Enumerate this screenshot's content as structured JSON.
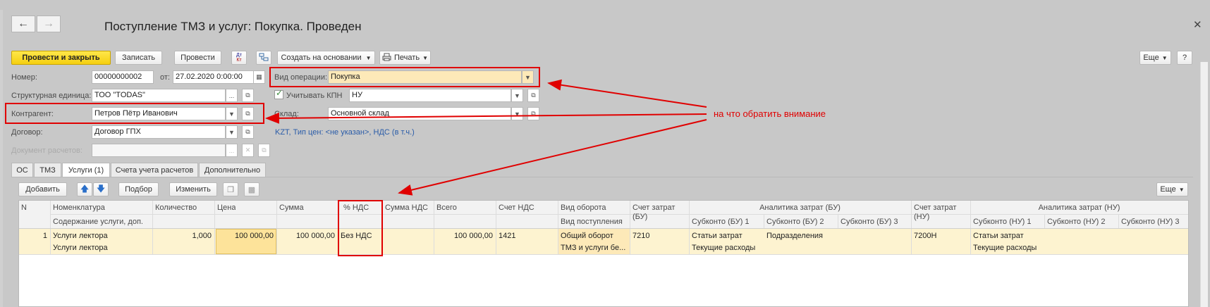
{
  "window": {
    "title": "Поступление ТМЗ и услуг: Покупка. Проведен",
    "close_icon": "close-icon",
    "star_icon": "star-icon"
  },
  "nav": {
    "back_icon": "arrow-left-icon",
    "forward_icon": "arrow-right-icon"
  },
  "toolbar": {
    "post_close": "Провести и закрыть",
    "save": "Записать",
    "post": "Провести",
    "dtkt_top": "Дт",
    "dtkt_bottom": "Кт",
    "create_based": "Создать на основании",
    "print": "Печать",
    "more": "Еще",
    "help": "?"
  },
  "form": {
    "number_label": "Номер:",
    "number_value": "00000000002",
    "date_label": "от:",
    "date_value": "27.02.2020  0:00:00",
    "operation_label": "Вид операции:",
    "operation_value": "Покупка",
    "unit_label": "Структурная единица:",
    "unit_value": "ТОО \"TODAS\"",
    "kpn_label": "Учитывать КПН",
    "kpn_value": "НУ",
    "counterparty_label": "Контрагент:",
    "counterparty_value": "Петров Пётр Иванович",
    "warehouse_label": "Склад:",
    "warehouse_value": "Основной склад",
    "contract_label": "Договор:",
    "contract_value": "Договор ГПХ",
    "price_info": "KZT, Тип цен: <не указан>, НДС (в т.ч.)",
    "settlement_doc_label": "Документ расчетов:",
    "settlement_doc_value": ""
  },
  "tabs": [
    "ОС",
    "ТМЗ",
    "Услуги (1)",
    "Счета учета расчетов",
    "Дополнительно"
  ],
  "table_toolbar": {
    "add": "Добавить",
    "pick": "Подбор",
    "edit": "Изменить",
    "more": "Еще"
  },
  "table": {
    "headers": {
      "n": "N",
      "nomenclature": "Номенклатура",
      "content": "Содержание услуги, доп.",
      "qty": "Количество",
      "price": "Цена",
      "sum": "Сумма",
      "vat_rate": "% НДС",
      "vat_sum": "Сумма НДС",
      "total": "Всего",
      "vat_account": "Счет НДС",
      "turnover": "Вид оборота",
      "receipt_type": "Вид поступления",
      "cost_account_bu": "Счет затрат (БУ)",
      "analytics_bu": "Аналитика затрат (БУ)",
      "sub_bu1": "Субконто (БУ) 1",
      "sub_bu2": "Субконто (БУ) 2",
      "sub_bu3": "Субконто (БУ) 3",
      "cost_account_nu": "Счет затрат (НУ)",
      "analytics_nu": "Аналитика затрат (НУ)",
      "sub_nu1": "Субконто (НУ) 1",
      "sub_nu2": "Субконто (НУ) 2",
      "sub_nu3": "Субконто (НУ) 3"
    },
    "rows": [
      {
        "n": "1",
        "nomenclature": "Услуги лектора",
        "content": "Услуги лектора",
        "qty": "1,000",
        "price": "100 000,00",
        "sum": "100 000,00",
        "vat_rate": "Без НДС",
        "vat_sum": "",
        "total": "100 000,00",
        "vat_account": "1421",
        "turnover": "Общий оборот",
        "receipt_type": "ТМЗ и услуги бе...",
        "cost_account_bu": "7210",
        "sub_bu1": "Статьи затрат",
        "sub_bu1_value": "Текущие расходы",
        "sub_bu2": "Подразделения",
        "cost_account_nu": "7200Н",
        "sub_nu1": "Статьи затрат",
        "sub_nu1_value": "Текущие расходы"
      }
    ]
  },
  "annotation": {
    "text": "на что обратить внимание",
    "color": "#e00000"
  }
}
